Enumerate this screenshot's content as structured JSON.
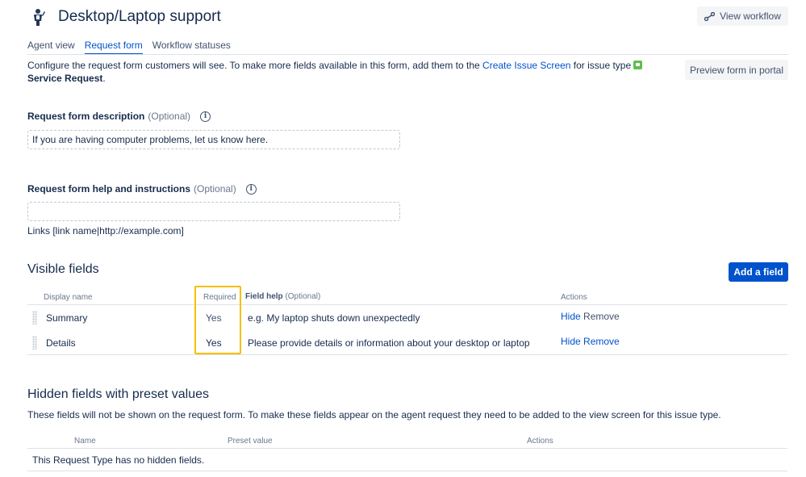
{
  "header": {
    "title": "Desktop/Laptop support",
    "view_workflow_label": "View workflow"
  },
  "tabs": [
    {
      "label": "Agent view",
      "active": false
    },
    {
      "label": "Request form",
      "active": true
    },
    {
      "label": "Workflow statuses",
      "active": false
    }
  ],
  "intro": {
    "text_before_link": "Configure the request form customers will see. To make more fields available in this form, add them to the",
    "link": "Create Issue Screen",
    "text_after_link": "for issue type",
    "issue_type": "Service Request",
    "period": "."
  },
  "preview_button_label": "Preview form in portal",
  "description_field": {
    "label": "Request form description",
    "optional": "(Optional)",
    "value": "If you are having computer problems, let us know here."
  },
  "help_field": {
    "label": "Request form help and instructions",
    "optional": "(Optional)",
    "value": "",
    "hint": "Links [link name|http://example.com]"
  },
  "visible_fields": {
    "title": "Visible fields",
    "add_button_label": "Add a field",
    "columns": {
      "display_name": "Display name",
      "required": "Required",
      "field_help": "Field help",
      "field_help_optional": "(Optional)",
      "actions": "Actions"
    },
    "rows": [
      {
        "name": "Summary",
        "required": "Yes",
        "help": "e.g. My laptop shuts down unexpectedly",
        "hide": "Hide",
        "remove": "Remove"
      },
      {
        "name": "Details",
        "required": "Yes",
        "help": "Please provide details or information about your desktop or laptop",
        "hide": "Hide",
        "remove": "Remove"
      }
    ]
  },
  "hidden_fields": {
    "title": "Hidden fields with preset values",
    "description": "These fields will not be shown on the request form. To make these fields appear on the agent request they need to be added to the view screen for this issue type.",
    "columns": {
      "name": "Name",
      "preset_value": "Preset value",
      "actions": "Actions"
    },
    "empty_text": "This Request Type has no hidden fields."
  },
  "colors": {
    "accent": "#0052cc",
    "highlight": "#f5c000",
    "issue_type_green": "#5fbf4d"
  }
}
